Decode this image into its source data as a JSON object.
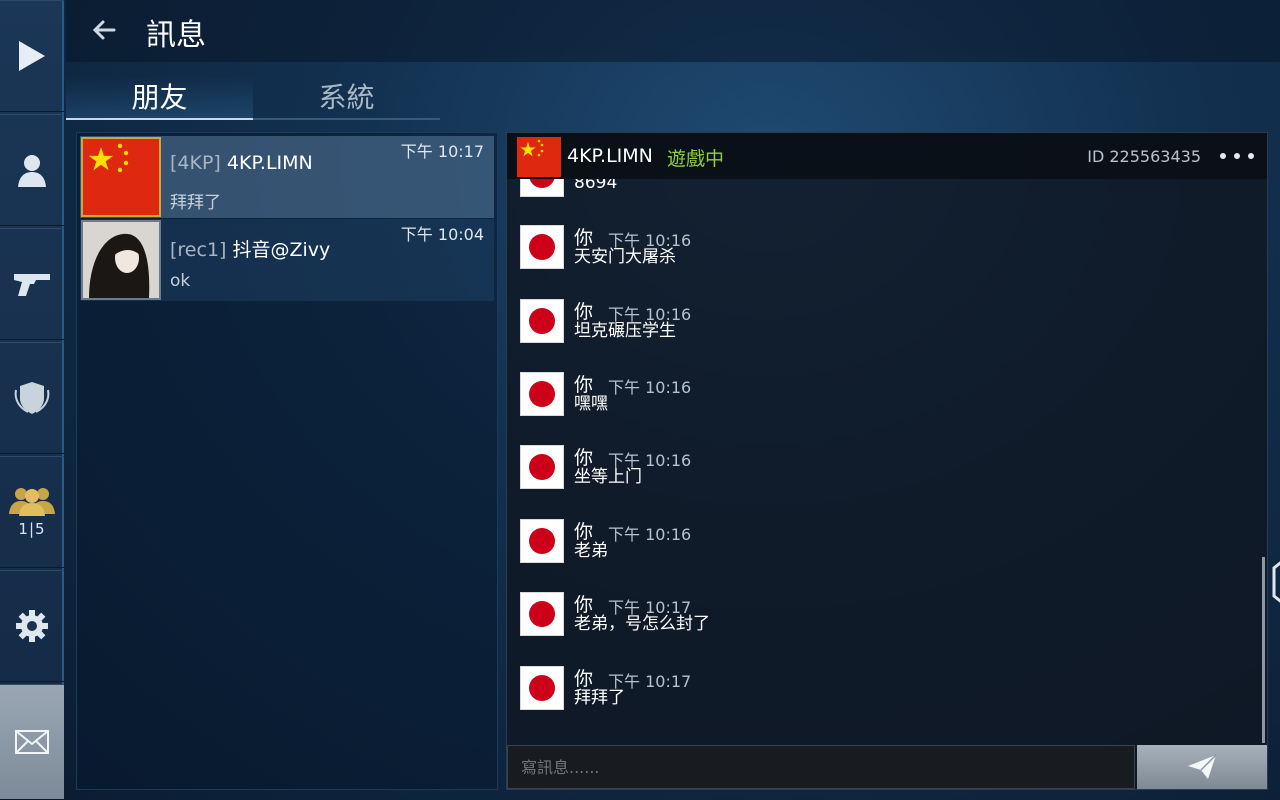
{
  "header": {
    "title": "訊息"
  },
  "tabs": [
    {
      "label": "朋友",
      "active": true
    },
    {
      "label": "系統",
      "active": false
    }
  ],
  "rail": {
    "items": [
      {
        "icon": "play-icon"
      },
      {
        "icon": "profile-icon"
      },
      {
        "icon": "pistol-icon"
      },
      {
        "icon": "shield-emblem-icon"
      },
      {
        "icon": "party-icon",
        "count": "1|5"
      },
      {
        "icon": "gear-icon"
      },
      {
        "icon": "mail-icon",
        "active": true
      }
    ]
  },
  "friends": [
    {
      "tag": "[4KP]",
      "name": "4KP.LIMN",
      "time": "下午 10:17",
      "last_message": "拜拜了",
      "avatar": "china-flag",
      "selected": true
    },
    {
      "tag": "[rec1]",
      "name": "抖音@Zivy",
      "time": "下午 10:04",
      "last_message": "ok",
      "avatar": "photo",
      "selected": false
    }
  ],
  "chat": {
    "name": "4KP.LIMN",
    "status": "遊戲中",
    "id_text": "ID 225563435",
    "partial_top_text": "8694",
    "messages": [
      {
        "sender": "你",
        "time": "下午 10:16",
        "text": "天安门大屠杀"
      },
      {
        "sender": "你",
        "time": "下午 10:16",
        "text": "坦克碾压学生"
      },
      {
        "sender": "你",
        "time": "下午 10:16",
        "text": "嘿嘿"
      },
      {
        "sender": "你",
        "time": "下午 10:16",
        "text": "坐等上门"
      },
      {
        "sender": "你",
        "time": "下午 10:16",
        "text": "老弟"
      },
      {
        "sender": "你",
        "time": "下午 10:17",
        "text": "老弟，号怎么封了"
      },
      {
        "sender": "你",
        "time": "下午 10:17",
        "text": "拜拜了"
      }
    ],
    "input_placeholder": "寫訊息......"
  },
  "colors": {
    "status_online": "#8fcf3a",
    "accent_blue": "#2a5a86",
    "selected_border": "#c7a940"
  }
}
